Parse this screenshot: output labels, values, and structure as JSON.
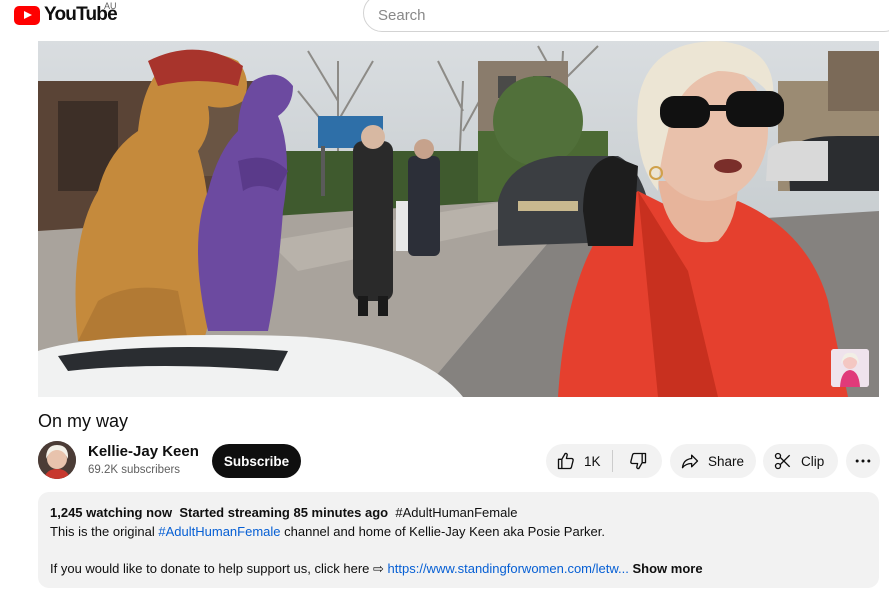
{
  "header": {
    "logo_text": "YouTube",
    "region": "AU",
    "search_placeholder": "Search"
  },
  "video": {
    "title": "On my way"
  },
  "channel": {
    "name": "Kellie-Jay Keen",
    "subscribers": "69.2K subscribers",
    "subscribe_label": "Subscribe"
  },
  "actions": {
    "like_count": "1K",
    "share_label": "Share",
    "clip_label": "Clip"
  },
  "description": {
    "watching": "1,245 watching now",
    "started": "Started streaming 85 minutes ago",
    "hashtag": "#AdultHumanFemale",
    "line1_prefix": "This is the original ",
    "line1_tag": "#AdultHumanFemale",
    "line1_suffix": " channel and home of Kellie-Jay Keen aka Posie Parker.",
    "line2_prefix": "If you would like to donate to help support us, click here ⇨ ",
    "line2_link": "https://www.standingforwomen.com/letw...",
    "show_more": "Show more"
  },
  "colors": {
    "brand_red": "#ff0000",
    "link_blue": "#065fd4",
    "pill_bg": "#f2f2f2",
    "subscribe_bg": "#0f0f0f"
  },
  "icons": [
    "youtube-logo-icon",
    "thumbs-up-icon",
    "thumbs-down-icon",
    "share-arrow-icon",
    "scissors-icon",
    "more-dots-icon"
  ]
}
